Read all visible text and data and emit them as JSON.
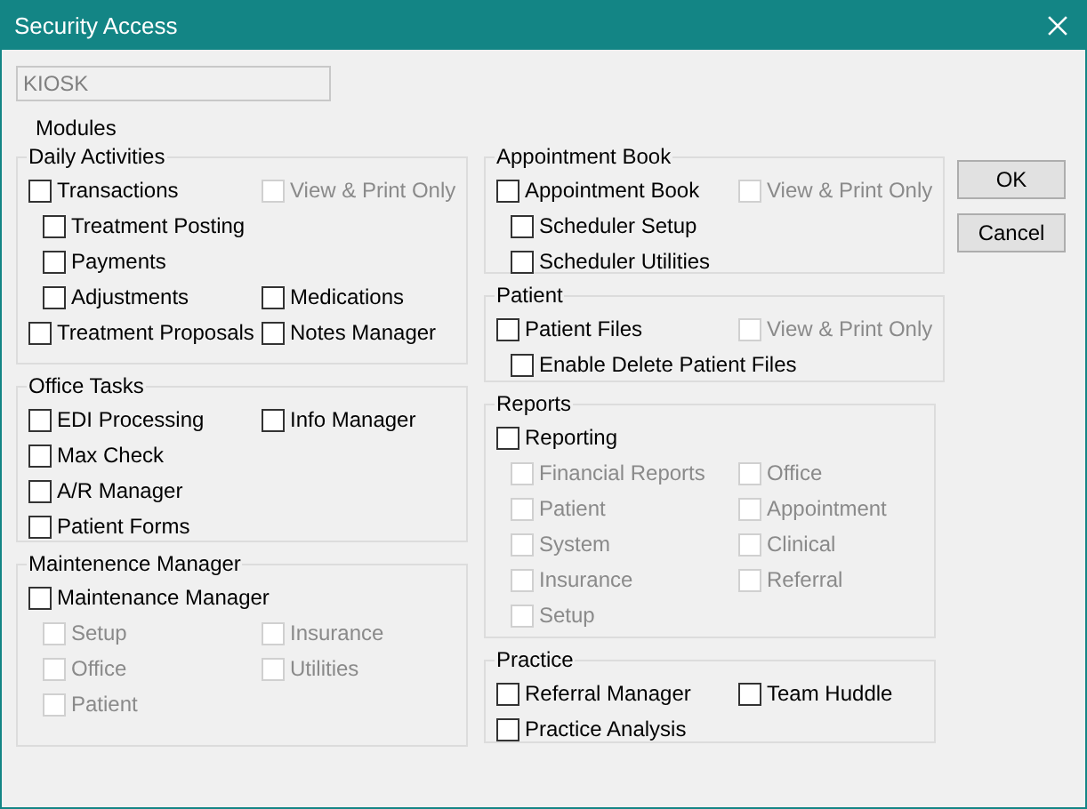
{
  "window": {
    "title": "Security Access"
  },
  "user_field": {
    "value": "KIOSK",
    "disabled": true
  },
  "modules_label": "Modules",
  "left_groups": [
    {
      "title": "Daily Activities",
      "rows": [
        {
          "left": {
            "label": "Transactions",
            "kind": "main",
            "checked": false,
            "disabled": false
          },
          "right": {
            "label": "View & Print Only",
            "kind": "main",
            "checked": false,
            "disabled": true
          }
        },
        {
          "left": {
            "label": "Treatment Posting",
            "kind": "sub",
            "checked": false,
            "disabled": false
          }
        },
        {
          "left": {
            "label": "Payments",
            "kind": "sub",
            "checked": false,
            "disabled": false
          }
        },
        {
          "left": {
            "label": "Adjustments",
            "kind": "sub",
            "checked": false,
            "disabled": false
          },
          "right": {
            "label": "Medications",
            "kind": "main",
            "checked": false,
            "disabled": false
          }
        },
        {
          "left": {
            "label": "Treatment Proposals",
            "kind": "main",
            "checked": false,
            "disabled": false
          },
          "right": {
            "label": "Notes Manager",
            "kind": "main",
            "checked": false,
            "disabled": false
          }
        }
      ]
    },
    {
      "title": "Office Tasks",
      "rows": [
        {
          "left": {
            "label": "EDI Processing",
            "kind": "main",
            "checked": false,
            "disabled": false
          },
          "right": {
            "label": "Info Manager",
            "kind": "main",
            "checked": false,
            "disabled": false
          }
        },
        {
          "left": {
            "label": "Max Check",
            "kind": "main",
            "checked": false,
            "disabled": false
          }
        },
        {
          "left": {
            "label": "A/R Manager",
            "kind": "main",
            "checked": false,
            "disabled": false
          }
        },
        {
          "left": {
            "label": "Patient Forms",
            "kind": "main",
            "checked": false,
            "disabled": false
          }
        }
      ]
    },
    {
      "title": "Maintenence Manager",
      "rows": [
        {
          "left": {
            "label": "Maintenance Manager",
            "kind": "main",
            "checked": false,
            "disabled": false
          }
        },
        {
          "left": {
            "label": "Setup",
            "kind": "sub",
            "checked": false,
            "disabled": true
          },
          "right": {
            "label": "Insurance",
            "kind": "main",
            "checked": false,
            "disabled": true
          }
        },
        {
          "left": {
            "label": "Office",
            "kind": "sub",
            "checked": false,
            "disabled": true
          },
          "right": {
            "label": "Utilities",
            "kind": "main",
            "checked": false,
            "disabled": true
          }
        },
        {
          "left": {
            "label": "Patient",
            "kind": "sub",
            "checked": false,
            "disabled": true
          }
        }
      ]
    }
  ],
  "right_groups": [
    {
      "title": "Appointment Book",
      "rows": [
        {
          "left": {
            "label": "Appointment Book",
            "kind": "main",
            "checked": false,
            "disabled": false
          },
          "right": {
            "label": "View & Print Only",
            "kind": "main",
            "checked": false,
            "disabled": true
          }
        },
        {
          "left": {
            "label": "Scheduler Setup",
            "kind": "sub",
            "checked": false,
            "disabled": false
          }
        },
        {
          "left": {
            "label": "Scheduler Utilities",
            "kind": "sub",
            "checked": false,
            "disabled": false
          }
        }
      ]
    },
    {
      "title": "Patient",
      "rows": [
        {
          "left": {
            "label": "Patient Files",
            "kind": "main",
            "checked": false,
            "disabled": false
          },
          "right": {
            "label": "View & Print Only",
            "kind": "main",
            "checked": false,
            "disabled": true
          }
        },
        {
          "left": {
            "label": "Enable Delete Patient Files",
            "kind": "sub",
            "checked": false,
            "disabled": false
          }
        }
      ]
    },
    {
      "title": "Reports",
      "rows": [
        {
          "left": {
            "label": "Reporting",
            "kind": "main",
            "checked": false,
            "disabled": false
          }
        },
        {
          "left": {
            "label": "Financial Reports",
            "kind": "sub",
            "checked": false,
            "disabled": true
          },
          "right": {
            "label": "Office",
            "kind": "main",
            "checked": false,
            "disabled": true
          }
        },
        {
          "left": {
            "label": "Patient",
            "kind": "sub",
            "checked": false,
            "disabled": true
          },
          "right": {
            "label": "Appointment",
            "kind": "main",
            "checked": false,
            "disabled": true
          }
        },
        {
          "left": {
            "label": "System",
            "kind": "sub",
            "checked": false,
            "disabled": true
          },
          "right": {
            "label": "Clinical",
            "kind": "main",
            "checked": false,
            "disabled": true
          }
        },
        {
          "left": {
            "label": "Insurance",
            "kind": "sub",
            "checked": false,
            "disabled": true
          },
          "right": {
            "label": "Referral",
            "kind": "main",
            "checked": false,
            "disabled": true
          }
        },
        {
          "left": {
            "label": "Setup",
            "kind": "sub",
            "checked": false,
            "disabled": true
          }
        }
      ]
    },
    {
      "title": "Practice",
      "rows": [
        {
          "left": {
            "label": "Referral Manager",
            "kind": "main",
            "checked": false,
            "disabled": false
          },
          "right": {
            "label": "Team Huddle",
            "kind": "main",
            "checked": false,
            "disabled": false
          }
        },
        {
          "left": {
            "label": "Practice Analysis",
            "kind": "main",
            "checked": false,
            "disabled": false
          }
        }
      ]
    }
  ],
  "buttons": [
    "OK",
    "Cancel"
  ]
}
